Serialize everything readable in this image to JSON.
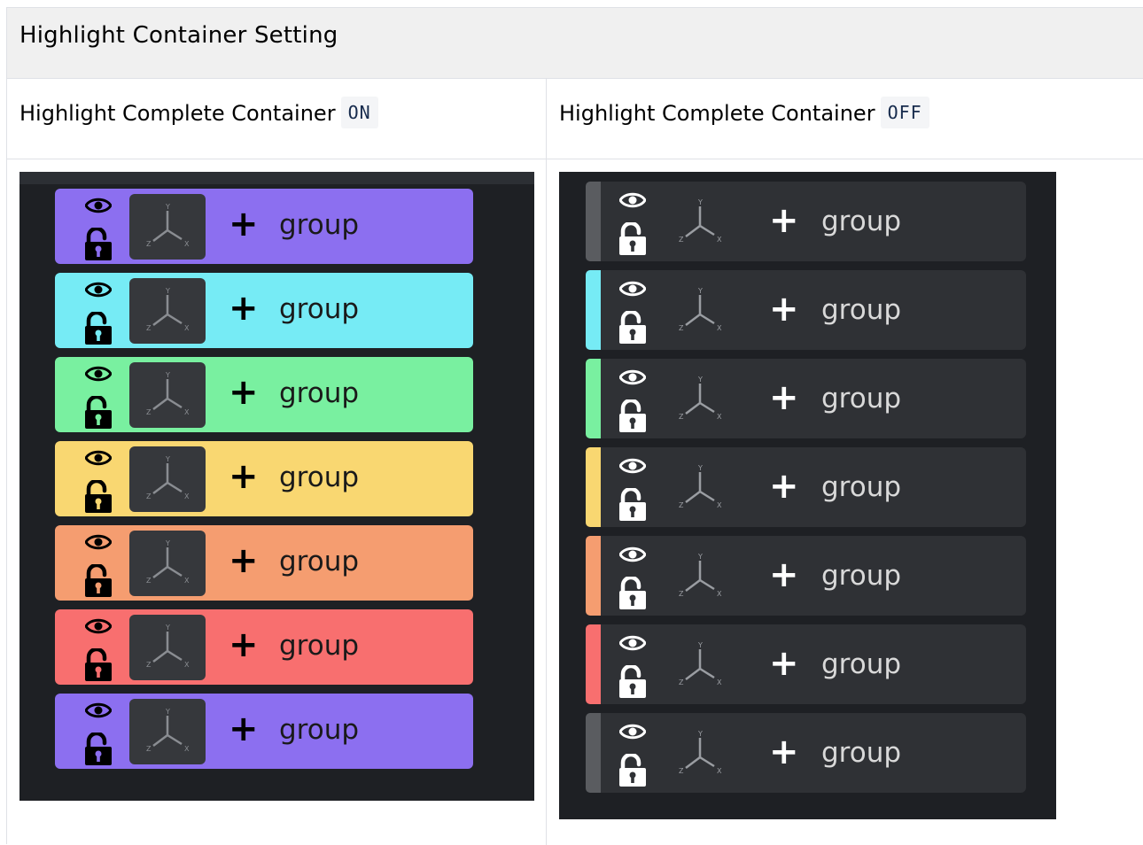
{
  "header": {
    "title": "Highlight Container Setting"
  },
  "columns": [
    {
      "caption": "Highlight Complete Container",
      "state": "ON"
    },
    {
      "caption": "Highlight Complete Container",
      "state": "OFF"
    }
  ],
  "panel_on": {
    "rows": [
      {
        "label": "group",
        "plus": "+",
        "color": "#8c6ff0"
      },
      {
        "label": "group",
        "plus": "+",
        "color": "#76ebf5"
      },
      {
        "label": "group",
        "plus": "+",
        "color": "#79f0a0"
      },
      {
        "label": "group",
        "plus": "+",
        "color": "#f9d771"
      },
      {
        "label": "group",
        "plus": "+",
        "color": "#f59d70"
      },
      {
        "label": "group",
        "plus": "+",
        "color": "#f86f6f"
      },
      {
        "label": "group",
        "plus": "+",
        "color": "#8c6ff0"
      }
    ]
  },
  "panel_off": {
    "rows": [
      {
        "label": "group",
        "plus": "+",
        "color": "#5a5c60"
      },
      {
        "label": "group",
        "plus": "+",
        "color": "#76ebf5"
      },
      {
        "label": "group",
        "plus": "+",
        "color": "#79f0a0"
      },
      {
        "label": "group",
        "plus": "+",
        "color": "#f9d771"
      },
      {
        "label": "group",
        "plus": "+",
        "color": "#f59d70"
      },
      {
        "label": "group",
        "plus": "+",
        "color": "#f86f6f"
      },
      {
        "label": "group",
        "plus": "+",
        "color": "#5a5c60"
      }
    ]
  },
  "icons": {
    "eye": "eye-icon",
    "lock": "unlocked-padlock-icon",
    "axes": "xyz-axes-icon"
  }
}
